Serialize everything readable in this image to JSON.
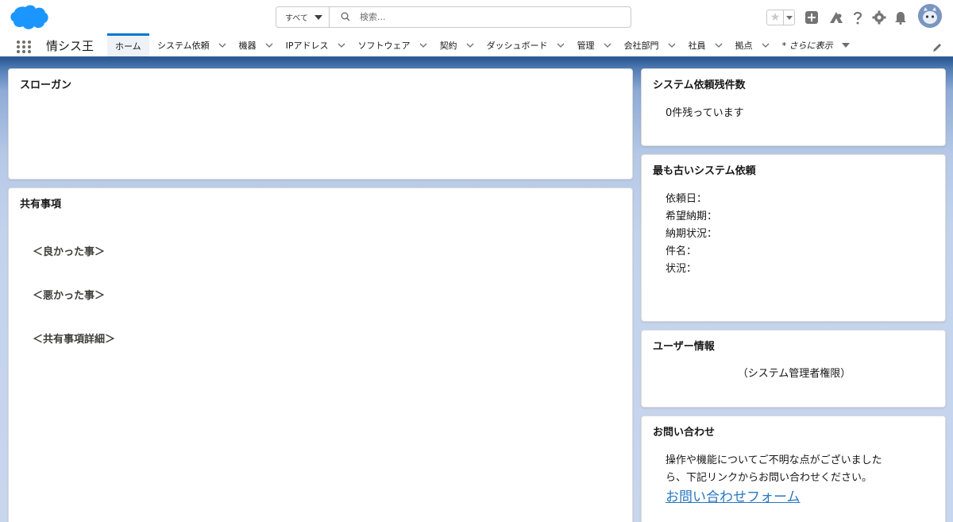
{
  "header": {
    "search_scope": "すべて",
    "search_placeholder": "検索..."
  },
  "nav": {
    "app_name": "情シス王",
    "items": [
      {
        "label": "ホーム",
        "active": true
      },
      {
        "label": "システム依頼"
      },
      {
        "label": "機器"
      },
      {
        "label": "IPアドレス"
      },
      {
        "label": "ソフトウェア"
      },
      {
        "label": "契約"
      },
      {
        "label": "ダッシュボード"
      },
      {
        "label": "管理"
      },
      {
        "label": "会社部門"
      },
      {
        "label": "社員"
      },
      {
        "label": "拠点"
      }
    ],
    "more_label": "* さらに表示"
  },
  "cards": {
    "slogan": {
      "title": "スローガン"
    },
    "shared": {
      "title": "共有事項",
      "good": "＜良かった事＞",
      "bad": "＜悪かった事＞",
      "detail": "＜共有事項詳細＞"
    },
    "remaining": {
      "title": "システム依頼残件数",
      "text": "0件残っています"
    },
    "oldest": {
      "title": "最も古いシステム依頼",
      "fields": [
        "依頼日：",
        "希望納期：",
        "納期状況：",
        "件名：",
        "状況："
      ]
    },
    "user": {
      "title": "ユーザー情報",
      "text": "（システム管理者権限）"
    },
    "contact": {
      "title": "お問い合わせ",
      "line1": "操作や機能についてご不明な点がございました",
      "line2": "ら、下記リンクからお問い合わせください。",
      "link": "お問い合わせフォーム"
    }
  },
  "colors": {
    "brand_blue": "#0176d3",
    "header_band": "#2e5b95",
    "link": "#2777c2"
  }
}
